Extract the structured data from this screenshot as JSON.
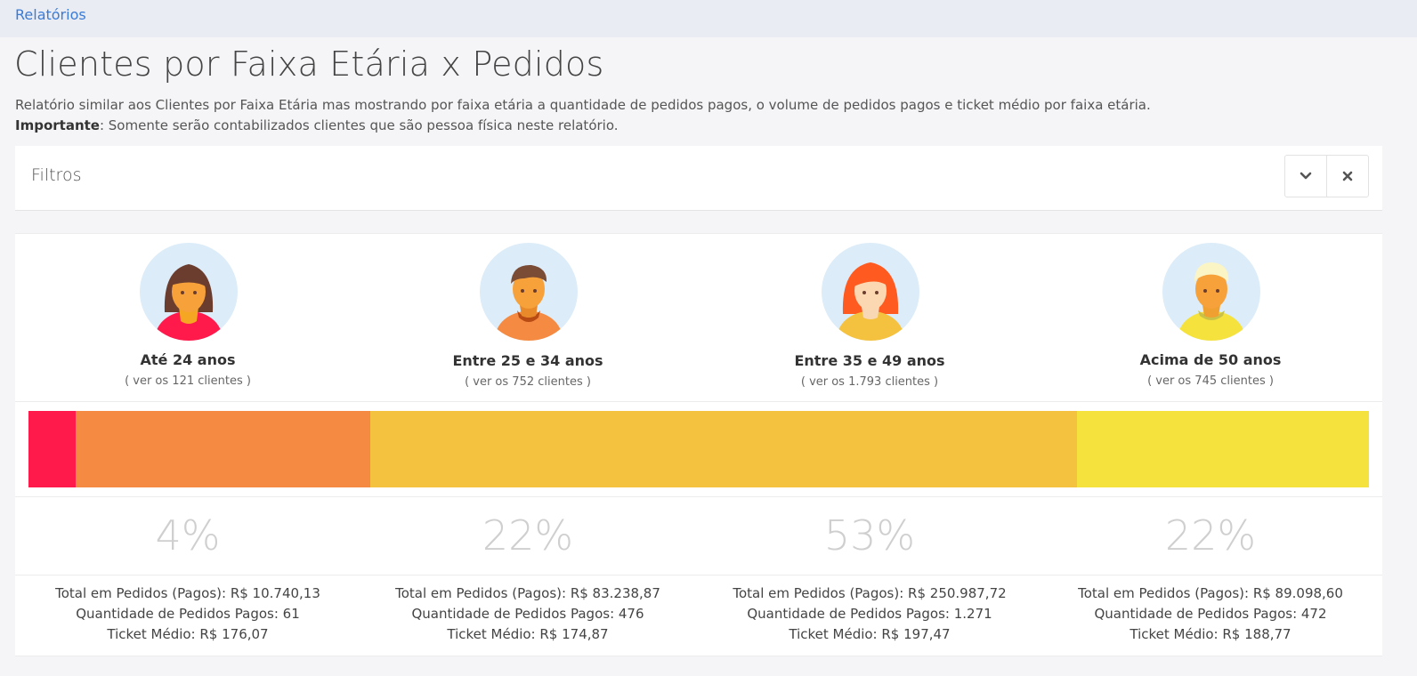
{
  "breadcrumb": "Relatórios",
  "page_title": "Clientes por Faixa Etária x Pedidos",
  "description": "Relatório similar aos Clientes por Faixa Etária mas mostrando por faixa etária a quantidade de pedidos pagos, o volume de pedidos pagos e ticket médio por faixa etária.",
  "important_label": "Importante",
  "important_text": ": Somente serão contabilizados clientes que são pessoa física neste relatório.",
  "filters": {
    "label": "Filtros",
    "collapse_icon": "chevron-down-icon",
    "close_icon": "close-icon"
  },
  "groups": [
    {
      "title": "Até 24 anos",
      "link": "( ver os 121 clientes )",
      "percent": "4%",
      "total": "Total em Pedidos (Pagos): R$ 10.740,13",
      "quantity": "Quantidade de Pedidos Pagos: 61",
      "ticket": "Ticket Médio: R$ 176,07",
      "bar_share": 3.5,
      "color": "#ff1a4b",
      "avatar": "young-woman-avatar"
    },
    {
      "title": "Entre 25 e 34 anos",
      "link": "( ver os 752 clientes )",
      "percent": "22%",
      "total": "Total em Pedidos (Pagos): R$ 83.238,87",
      "quantity": "Quantidade de Pedidos Pagos: 476",
      "ticket": "Ticket Médio: R$ 174,87",
      "bar_share": 22.0,
      "color": "#f58b42",
      "avatar": "man-avatar"
    },
    {
      "title": "Entre 35 e 49 anos",
      "link": "( ver os 1.793 clientes )",
      "percent": "53%",
      "total": "Total em Pedidos (Pagos): R$ 250.987,72",
      "quantity": "Quantidade de Pedidos Pagos: 1.271",
      "ticket": "Ticket Médio: R$ 197,47",
      "bar_share": 52.7,
      "color": "#f4c23f",
      "avatar": "woman-avatar"
    },
    {
      "title": "Acima de 50 anos",
      "link": "( ver os 745 clientes )",
      "percent": "22%",
      "total": "Total em Pedidos (Pagos): R$ 89.098,60",
      "quantity": "Quantidade de Pedidos Pagos: 472",
      "ticket": "Ticket Médio: R$ 188,77",
      "bar_share": 21.8,
      "color": "#f5e23d",
      "avatar": "older-man-avatar"
    }
  ]
}
